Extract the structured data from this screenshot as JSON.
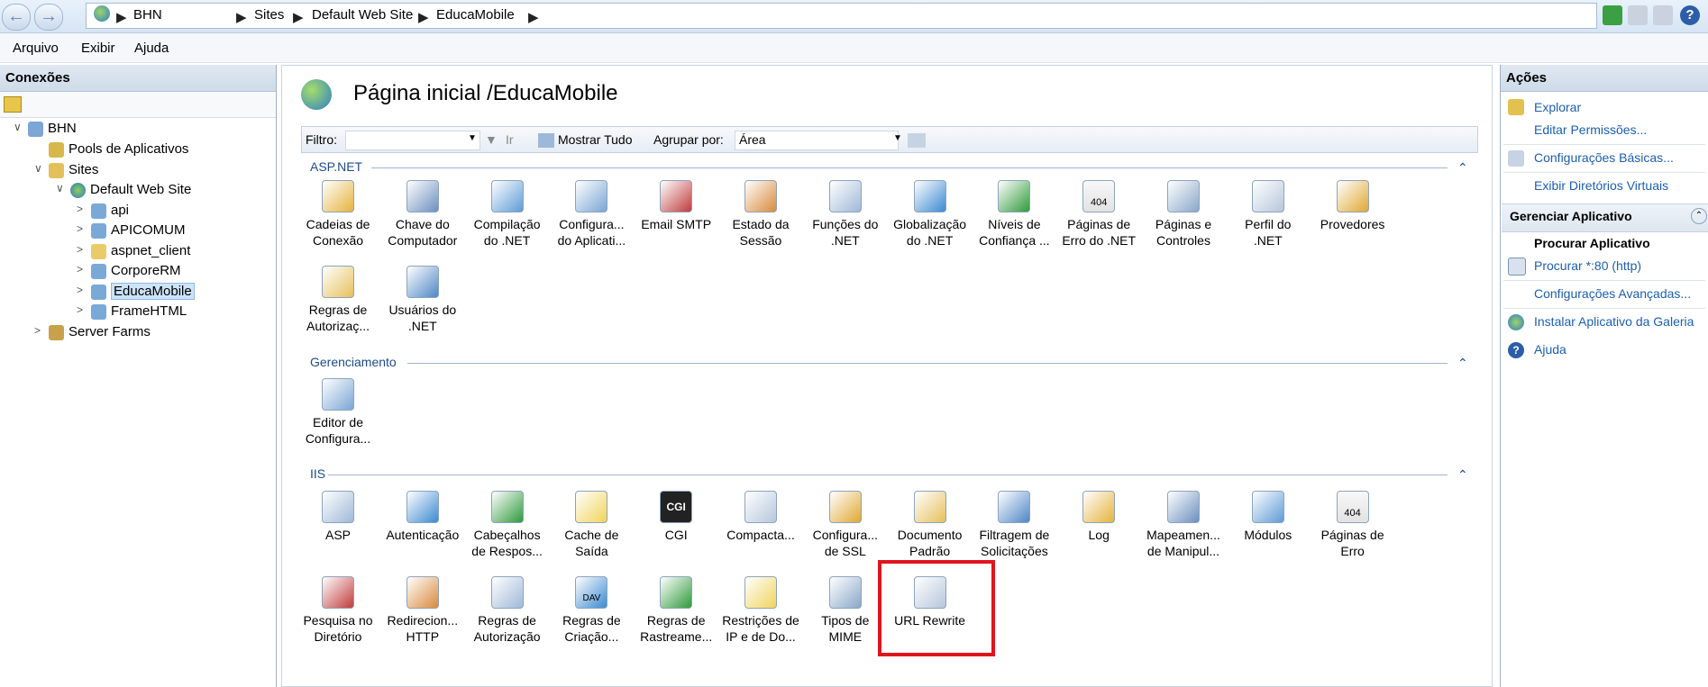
{
  "address_bar": {
    "crumbs": [
      "BHN",
      "Sites",
      "Default Web Site",
      "EducaMobile"
    ]
  },
  "menu": [
    "Arquivo",
    "Exibir",
    "Ajuda"
  ],
  "connections": {
    "title": "Conexões",
    "tree": [
      {
        "label": "BHN",
        "icon": "server-icon"
      },
      {
        "label": "Pools de Aplicativos",
        "icon": "app-pool-icon"
      },
      {
        "label": "Sites",
        "icon": "sites-folder-icon"
      },
      {
        "label": "Default Web Site",
        "icon": "globe-icon"
      },
      {
        "label": "api",
        "icon": "app-icon"
      },
      {
        "label": "APICOMUM",
        "icon": "app-icon"
      },
      {
        "label": "aspnet_client",
        "icon": "folder-icon"
      },
      {
        "label": "CorporeRM",
        "icon": "app-icon"
      },
      {
        "label": "EducaMobile",
        "icon": "app-icon"
      },
      {
        "label": "FrameHTML",
        "icon": "app-icon"
      },
      {
        "label": "Server Farms",
        "icon": "server-farm-icon"
      }
    ]
  },
  "main": {
    "title": "Página inicial /EducaMobile",
    "filter": {
      "label": "Filtro:",
      "go": "Ir",
      "show_all": "Mostrar Tudo",
      "group_by_label": "Agrupar por:",
      "group_by_value": "Área"
    },
    "groups": [
      {
        "name": "ASP.NET",
        "items": [
          [
            "Cadeias de",
            "Conexão"
          ],
          [
            "Chave do",
            "Computador"
          ],
          [
            "Compilação",
            "do .NET"
          ],
          [
            "Configura...",
            "do Aplicati..."
          ],
          [
            "Email SMTP",
            ""
          ],
          [
            "Estado da",
            "Sessão"
          ],
          [
            "Funções do",
            ".NET"
          ],
          [
            "Globalização",
            "do .NET"
          ],
          [
            "Níveis de",
            "Confiança ..."
          ],
          [
            "Páginas de",
            "Erro do .NET"
          ],
          [
            "Páginas e",
            "Controles"
          ],
          [
            "Perfil do",
            ".NET"
          ],
          [
            "Provedores",
            ""
          ],
          [
            "Regras de",
            "Autorizaç..."
          ],
          [
            "Usuários do",
            ".NET"
          ]
        ]
      },
      {
        "name": "Gerenciamento",
        "items": [
          [
            "Editor de",
            "Configura..."
          ]
        ]
      },
      {
        "name": "IIS",
        "items": [
          [
            "ASP",
            ""
          ],
          [
            "Autenticação",
            ""
          ],
          [
            "Cabeçalhos",
            "de Respos..."
          ],
          [
            "Cache de",
            "Saída"
          ],
          [
            "CGI",
            ""
          ],
          [
            "Compacta...",
            ""
          ],
          [
            "Configura...",
            "de SSL"
          ],
          [
            "Documento",
            "Padrão"
          ],
          [
            "Filtragem de",
            "Solicitações"
          ],
          [
            "Log",
            ""
          ],
          [
            "Mapeamen...",
            "de Manipul..."
          ],
          [
            "Módulos",
            ""
          ],
          [
            "Páginas de",
            "Erro"
          ],
          [
            "Pesquisa no",
            "Diretório"
          ],
          [
            "Redirecion...",
            "HTTP"
          ],
          [
            "Regras de",
            "Autorização"
          ],
          [
            "Regras de",
            "Criação..."
          ],
          [
            "Regras de",
            "Rastreame..."
          ],
          [
            "Restrições de",
            "IP e de Do..."
          ],
          [
            "Tipos de",
            "MIME"
          ],
          [
            "URL Rewrite",
            ""
          ]
        ]
      }
    ],
    "cgi_icon_text": "CGI",
    "error_icon_text": "404",
    "dav_icon_text": "DAV"
  },
  "actions": {
    "title": "Ações",
    "items": [
      "Explorar",
      "Editar Permissões...",
      "Configurações Básicas...",
      "Exibir Diretórios Virtuais"
    ],
    "section": "Gerenciar Aplicativo",
    "browse_title": "Procurar Aplicativo",
    "browse_link": "Procurar *:80 (http)",
    "advanced": "Configurações Avançadas...",
    "gallery": "Instalar Aplicativo da Galeria",
    "help": "Ajuda"
  },
  "colors": {
    "accent": "#1c5fb0",
    "highlight": "#e0141e"
  }
}
